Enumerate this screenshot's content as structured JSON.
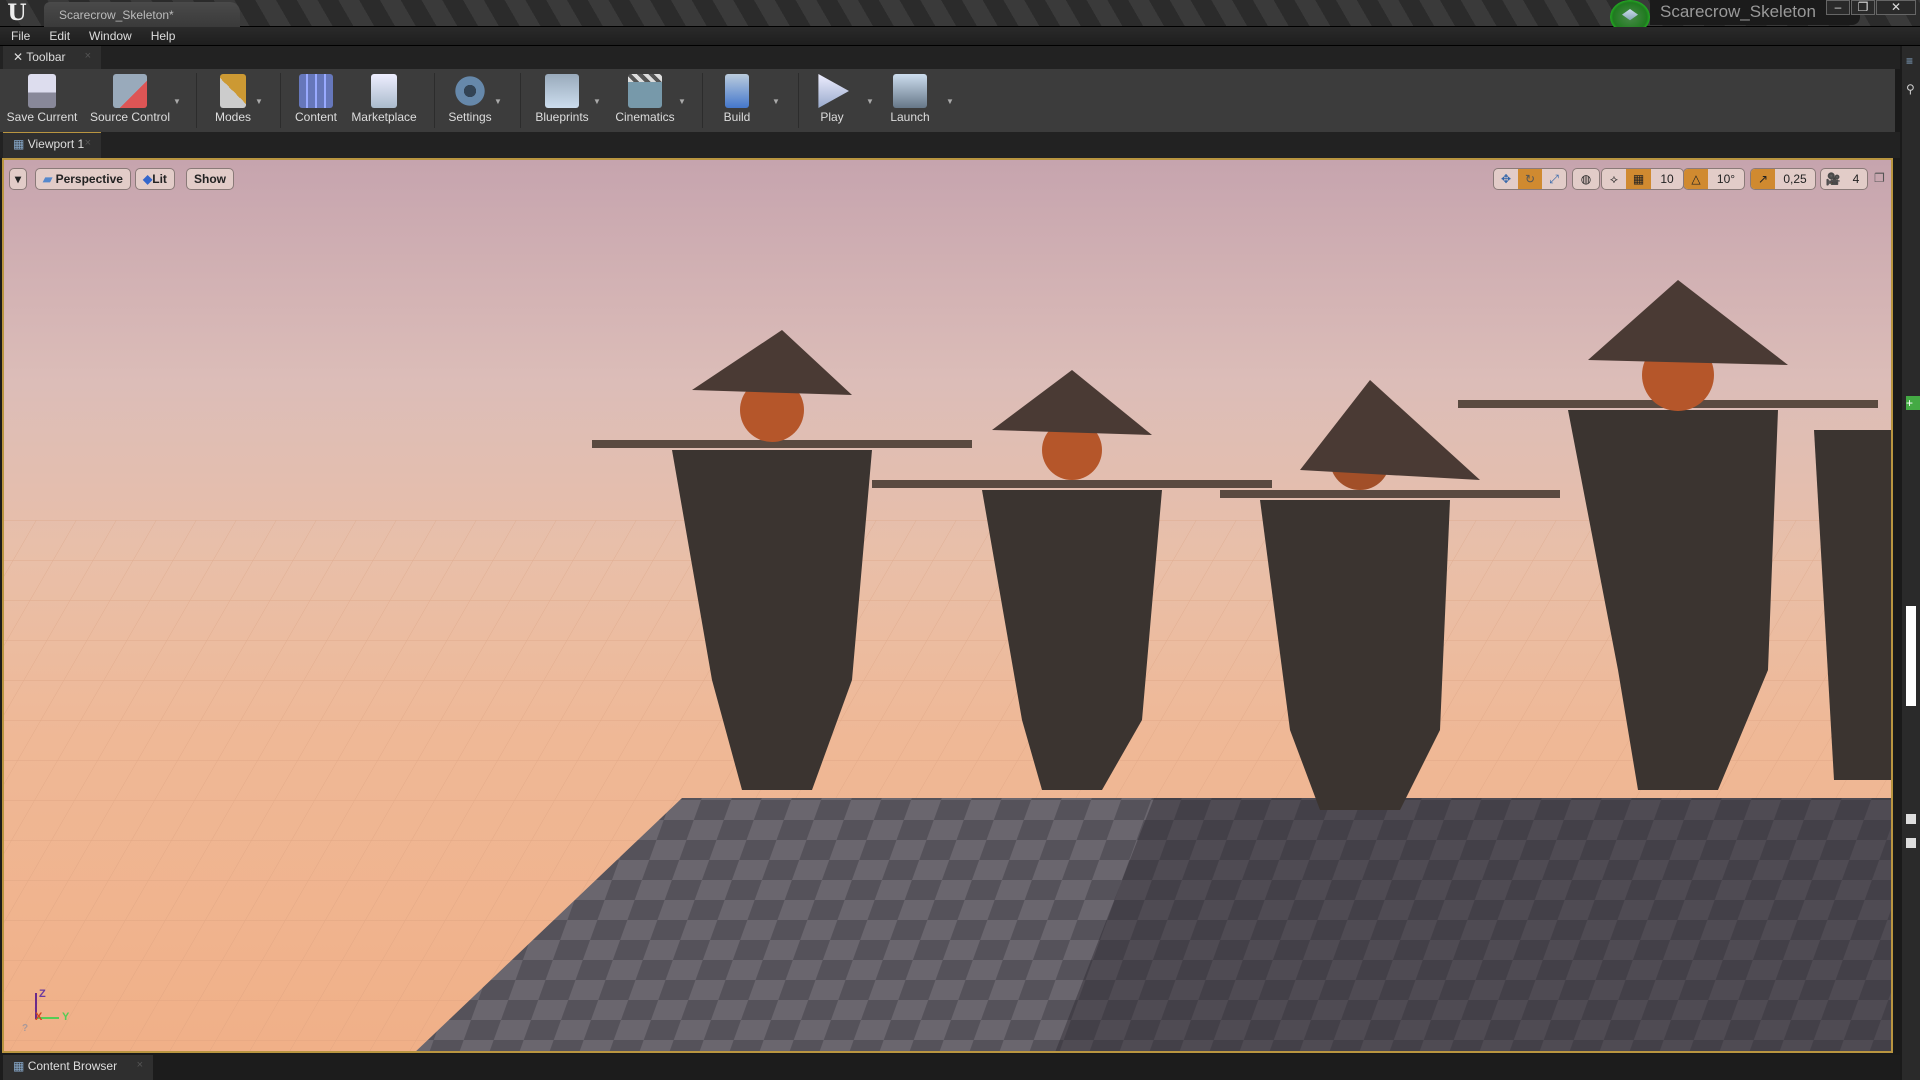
{
  "window": {
    "tab_title": "Scarecrow_Skeleton*",
    "project_name": "Scarecrow_Skeleton",
    "controls": [
      "minimize",
      "restore",
      "close"
    ]
  },
  "menu": [
    "File",
    "Edit",
    "Window",
    "Help"
  ],
  "toolbar_tab": {
    "label": "Toolbar"
  },
  "toolbar": [
    {
      "label": "Save Current",
      "icon": "floppy-icon",
      "dropdown": false
    },
    {
      "label": "Source Control",
      "icon": "source-control-icon",
      "dropdown": true
    },
    {
      "label": "Modes",
      "icon": "modes-icon",
      "dropdown": true
    },
    {
      "label": "Content",
      "icon": "content-icon",
      "dropdown": false
    },
    {
      "label": "Marketplace",
      "icon": "marketplace-icon",
      "dropdown": false
    },
    {
      "label": "Settings",
      "icon": "gear-icon",
      "dropdown": true
    },
    {
      "label": "Blueprints",
      "icon": "blueprint-icon",
      "dropdown": true
    },
    {
      "label": "Cinematics",
      "icon": "clapper-icon",
      "dropdown": true
    },
    {
      "label": "Build",
      "icon": "build-icon",
      "dropdown": true
    },
    {
      "label": "Play",
      "icon": "play-icon",
      "dropdown": true
    },
    {
      "label": "Launch",
      "icon": "launch-icon",
      "dropdown": true
    }
  ],
  "viewport_tab": {
    "label": "Viewport 1"
  },
  "viewport_toolbar": {
    "perspective": "Perspective",
    "lit": "Lit",
    "show": "Show",
    "grid_snap": "10",
    "rotation_snap": "10°",
    "scale_snap": "0,25",
    "camera_speed": "4"
  },
  "axis": {
    "z": "Z",
    "x": "X",
    "y": "Y"
  },
  "bottom_tab": {
    "label": "Content Browser"
  },
  "colors": {
    "accent": "#d08a30",
    "viewport_border": "#b99540"
  }
}
